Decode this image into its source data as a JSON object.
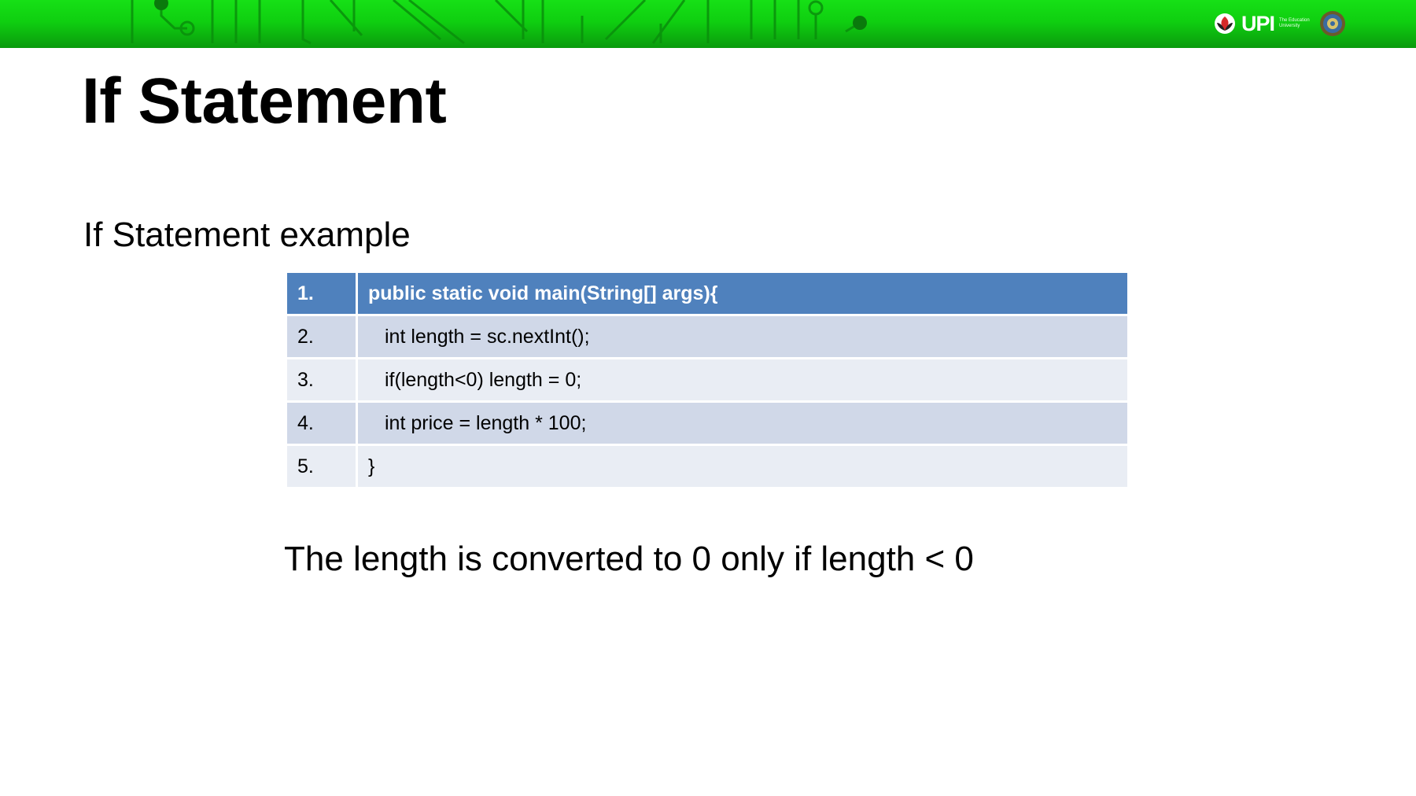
{
  "slide": {
    "title": "If Statement",
    "subtitle": "If Statement example",
    "note": "The length is converted to 0 only if length < 0"
  },
  "branding": {
    "logo_text": "UPI",
    "logo_subtext": "The Education University",
    "header_color": "#10d010",
    "icons": [
      "upi-flower-icon",
      "university-seal-icon"
    ]
  },
  "code_table": {
    "header_color": "#4f81bd",
    "band_colors": [
      "#d0d8e8",
      "#e9edf4"
    ],
    "rows": [
      {
        "num": "1.",
        "code": "public static void main(String[] args){"
      },
      {
        "num": "2.",
        "code": "int length = sc.nextInt();"
      },
      {
        "num": "3.",
        "code": "if(length<0) length = 0;"
      },
      {
        "num": "4.",
        "code": "int price = length * 100;"
      },
      {
        "num": "5.",
        "code": "}"
      }
    ]
  }
}
